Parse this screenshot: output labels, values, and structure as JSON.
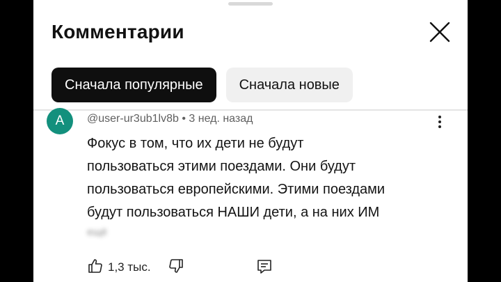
{
  "header": {
    "title": "Комментарии",
    "close_icon": "close-icon"
  },
  "sort_chips": [
    {
      "label": "Сначала популярные",
      "selected": true
    },
    {
      "label": "Сначала новые",
      "selected": false
    }
  ],
  "comment": {
    "avatar_letter": "A",
    "avatar_color": "#13907d",
    "author": "@user-ur3ub1lv8b",
    "separator": "•",
    "time": "3 нед. назад",
    "text_lines": [
      "Фокус в том, что их дети не будут",
      "пользоваться этими поездами. Они будут",
      "пользоваться европейскими. Этими поездами",
      "будут пользоваться НАШИ дети, а на них ИМ"
    ],
    "read_more": "ещё",
    "likes": "1,3 тыс."
  },
  "colors": {
    "background": "#000000",
    "sheet": "#ffffff",
    "chip_active_bg": "#0f0f0f",
    "chip_inactive_bg": "#f0f0f0"
  }
}
